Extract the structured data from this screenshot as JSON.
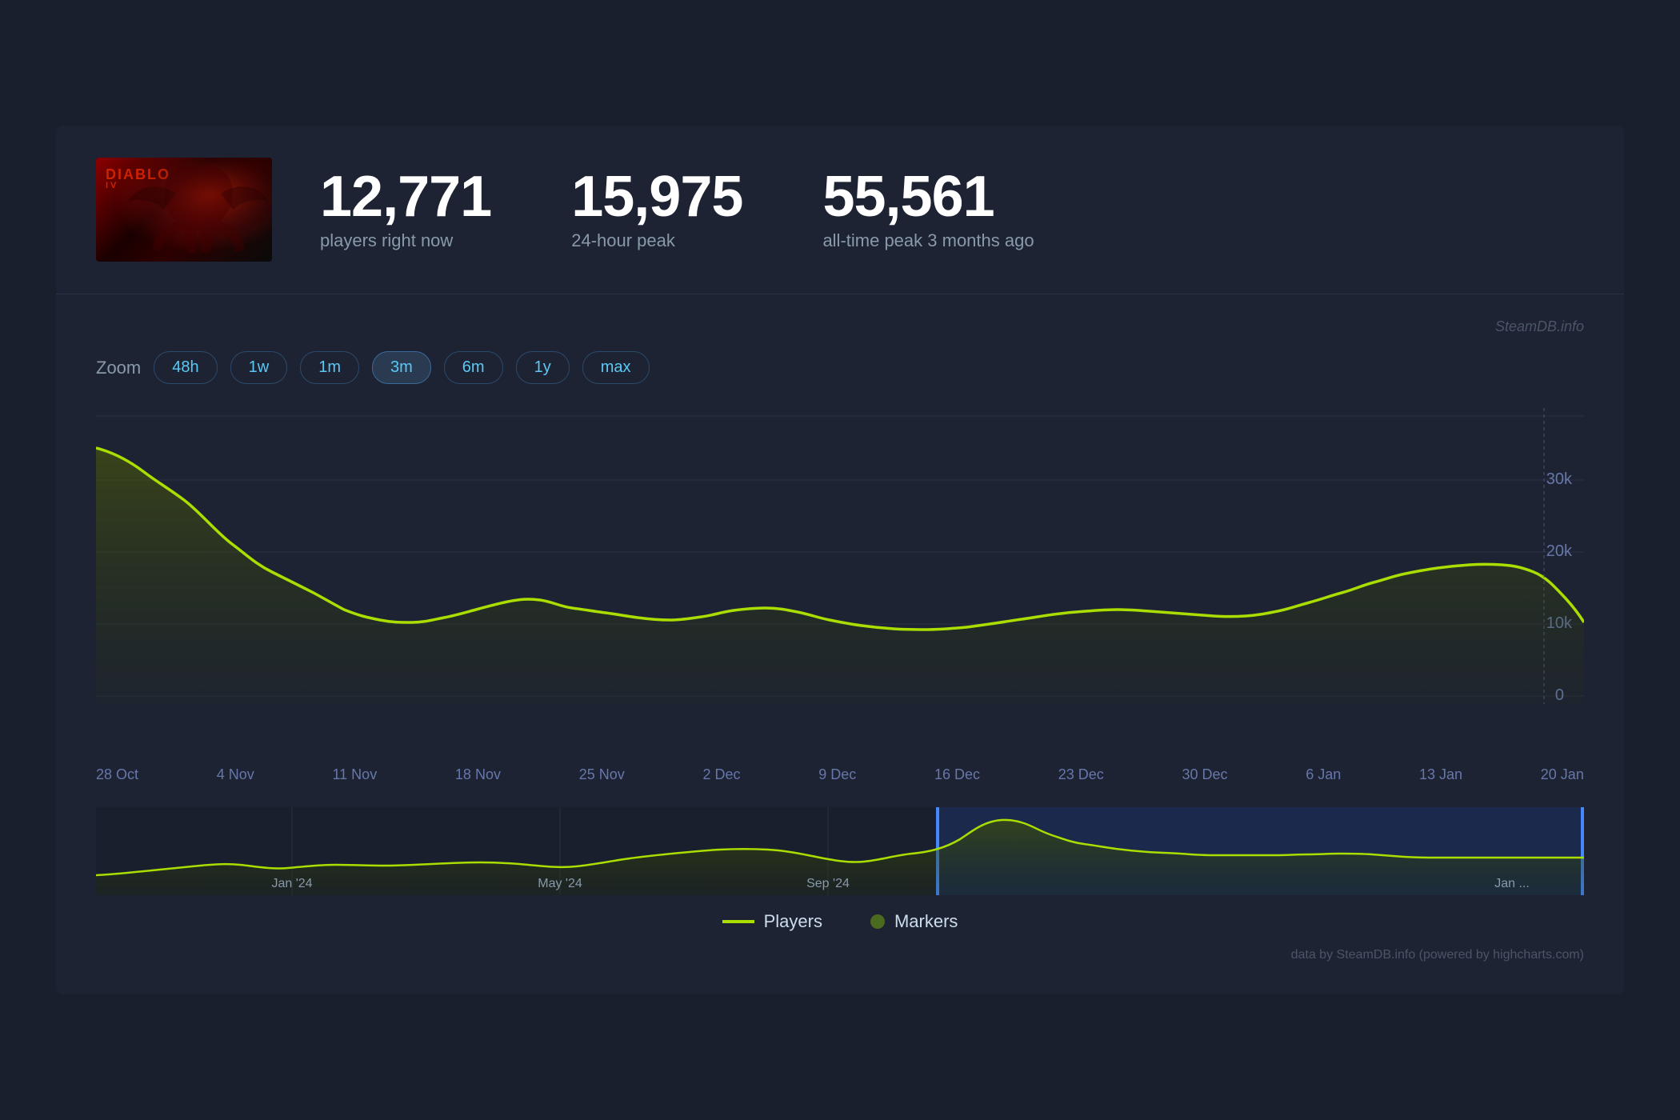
{
  "header": {
    "game_title": "Diablo IV",
    "thumbnail_alt": "Diablo IV game cover",
    "stats": {
      "current_players": {
        "value": "12,771",
        "label": "players right now"
      },
      "peak_24h": {
        "value": "15,975",
        "label": "24-hour peak"
      },
      "alltime_peak": {
        "value": "55,561",
        "label": "all-time peak 3 months ago"
      }
    }
  },
  "chart": {
    "zoom_buttons": [
      "48h",
      "1w",
      "1m",
      "3m",
      "6m",
      "1y",
      "max"
    ],
    "active_zoom": "3m",
    "zoom_label": "Zoom",
    "x_axis_labels": [
      "28 Oct",
      "4 Nov",
      "11 Nov",
      "18 Nov",
      "25 Nov",
      "2 Dec",
      "9 Dec",
      "16 Dec",
      "23 Dec",
      "30 Dec",
      "6 Jan",
      "13 Jan",
      "20 Jan"
    ],
    "y_axis_labels": [
      "0",
      "10k",
      "20k",
      "30k"
    ],
    "mini_x_labels": [
      "Jan '24",
      "May '24",
      "Sep '24",
      "Jan ..."
    ],
    "steamdb_credit": "SteamDB.info",
    "data_credit": "data by SteamDB.info (powered by highcharts.com)"
  },
  "legend": {
    "players_label": "Players",
    "markers_label": "Markers"
  }
}
